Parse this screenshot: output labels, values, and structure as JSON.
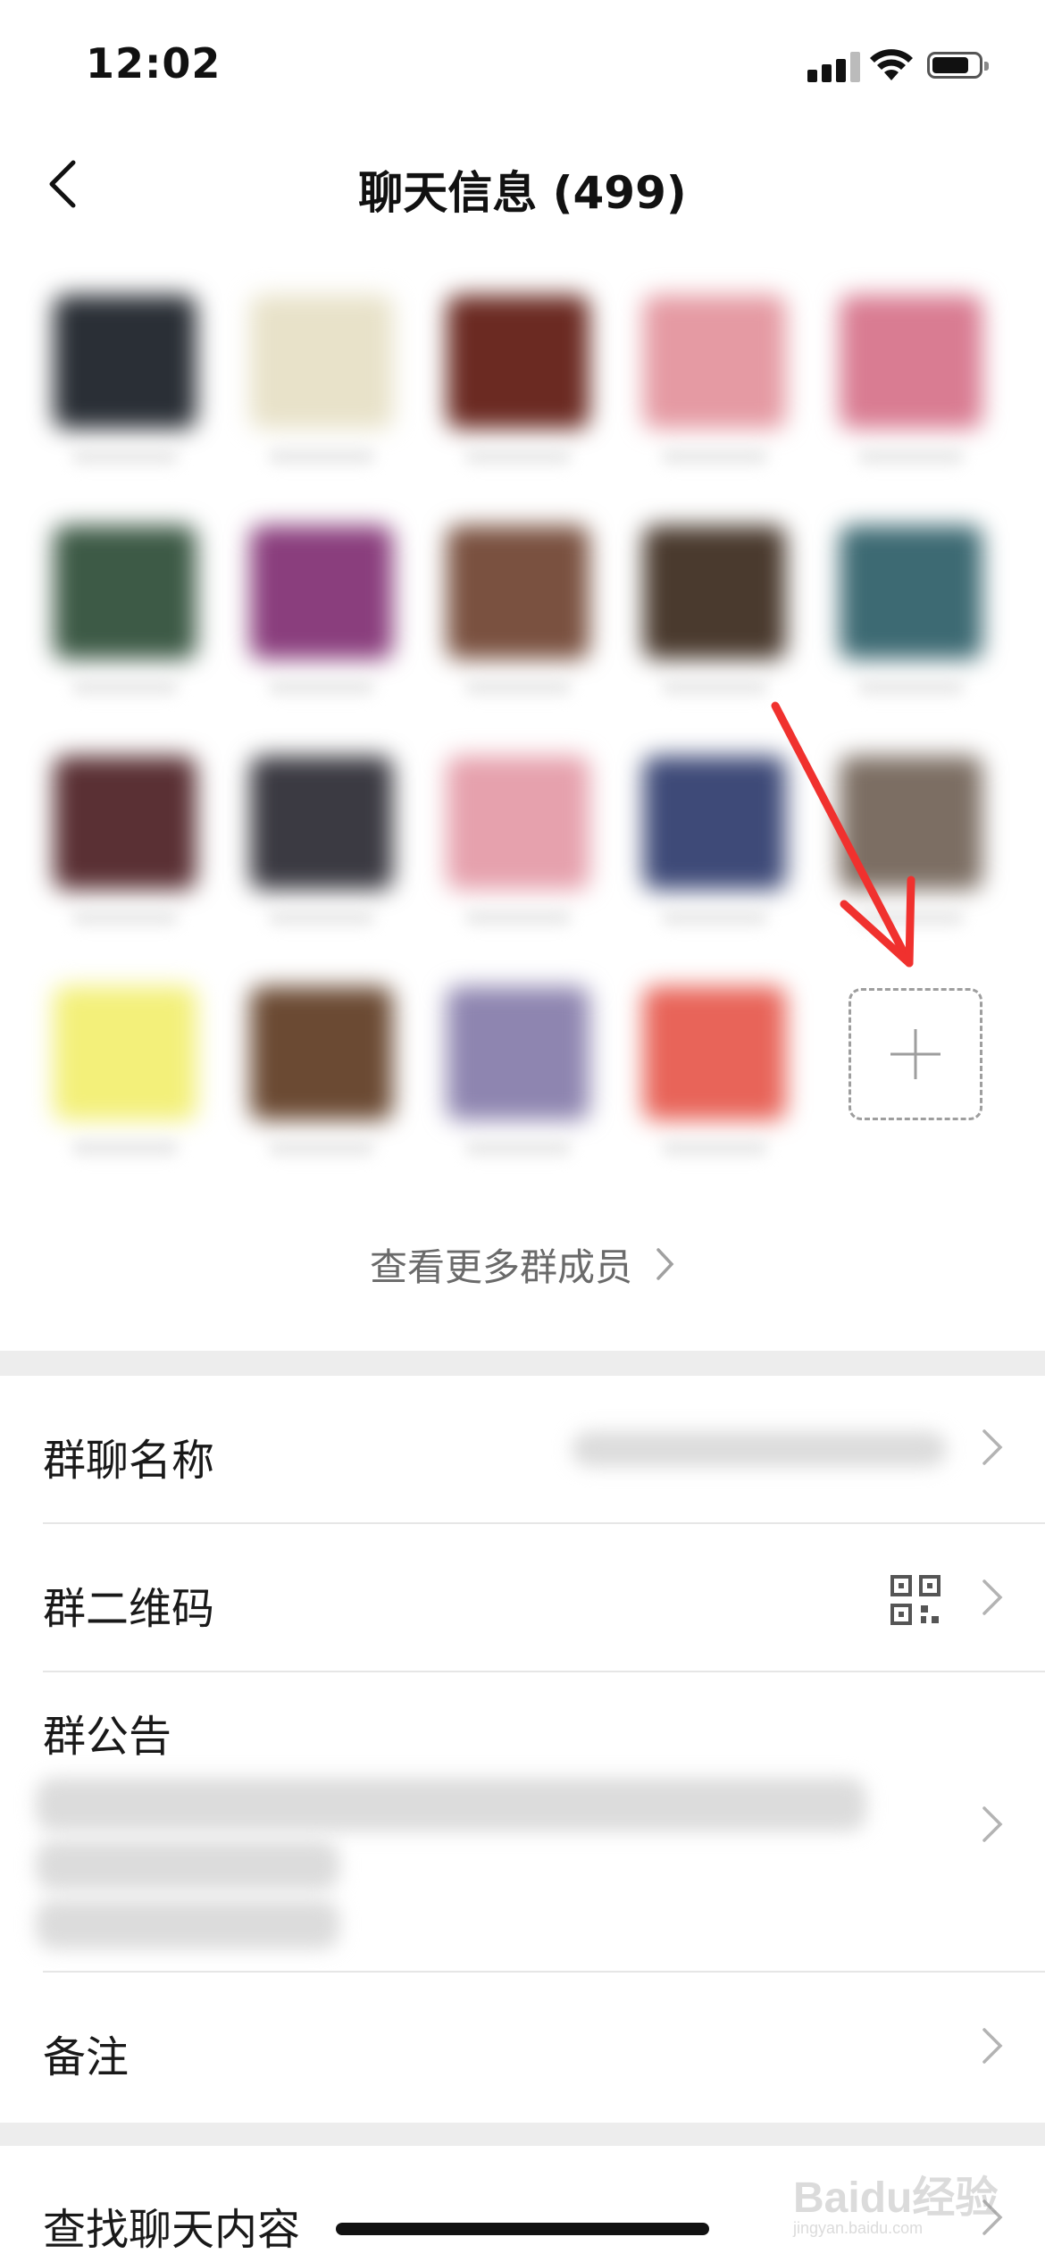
{
  "status_bar": {
    "time": "12:02"
  },
  "nav": {
    "title": "聊天信息 (499)"
  },
  "members": {
    "avatars": [
      {
        "color": "#2a2f36"
      },
      {
        "color": "#e8e2c9"
      },
      {
        "color": "#6b2a22"
      },
      {
        "color": "#e59aa3"
      },
      {
        "color": "#d97c92"
      },
      {
        "color": "#3d5a46"
      },
      {
        "color": "#8a3e7d"
      },
      {
        "color": "#7a5140"
      },
      {
        "color": "#4a3a2e"
      },
      {
        "color": "#3d6a73"
      },
      {
        "color": "#5a3034"
      },
      {
        "color": "#3b3a42"
      },
      {
        "color": "#e6a1ad"
      },
      {
        "color": "#3e4a78"
      },
      {
        "color": "#7c6e63"
      },
      {
        "color": "#f3f07a"
      },
      {
        "color": "#6b4a33"
      },
      {
        "color": "#8e85b0"
      },
      {
        "color": "#e86459"
      }
    ],
    "view_more_label": "查看更多群成员"
  },
  "settings": {
    "group_name_label": "群聊名称",
    "qr_code_label": "群二维码",
    "announcement_label": "群公告",
    "remark_label": "备注",
    "search_label": "查找聊天内容"
  },
  "watermark": {
    "text": "Baidu经验",
    "sub": "jingyan.baidu.com"
  },
  "colors": {
    "annotation_red": "#f0312e",
    "page_gap": "#ededed",
    "chevron": "#b3b3b3"
  }
}
